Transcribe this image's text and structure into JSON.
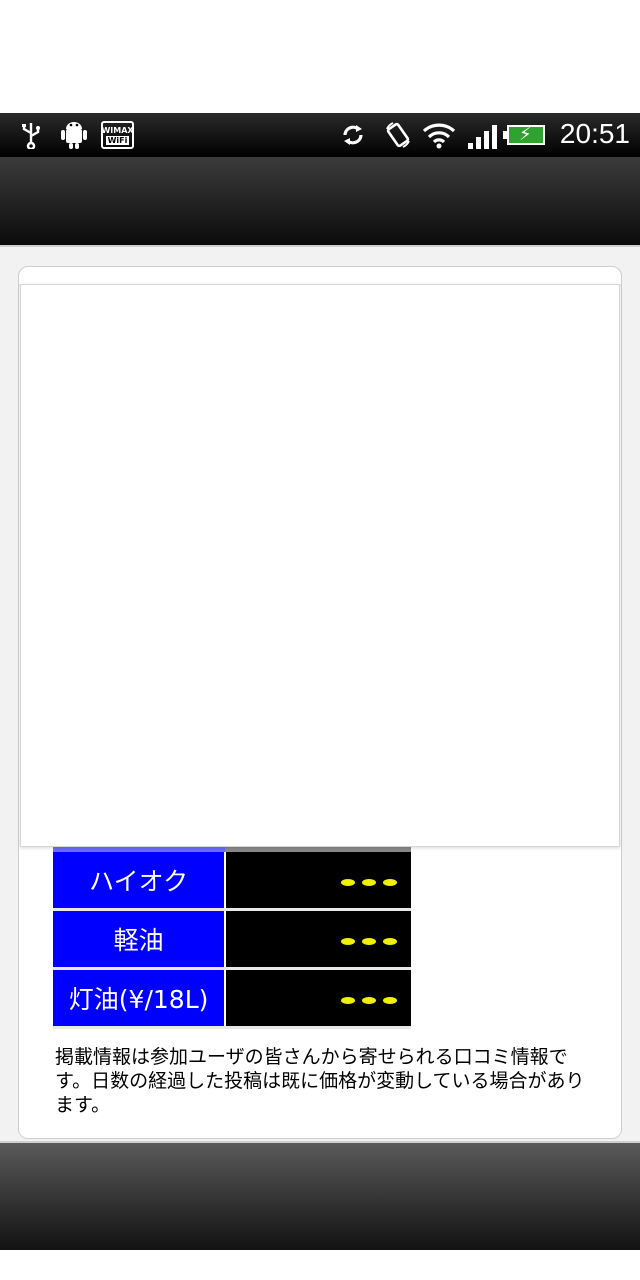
{
  "status_bar": {
    "time": "20:51",
    "icons": [
      "usb-icon",
      "android-debug-icon",
      "wimax-wifi-icon",
      "sync-icon",
      "rotate-icon",
      "wifi-icon",
      "signal-icon",
      "battery-charging-icon"
    ],
    "wimax_label": "WIMAX",
    "wimax_sub": "WiFi"
  },
  "price_table": {
    "rows": [
      {
        "fuel": "ハイオク"
      },
      {
        "fuel": "軽油"
      },
      {
        "fuel": "灯油(¥/18L)"
      }
    ]
  },
  "notice": "掲載情報は参加ユーザの皆さんから寄せられる口コミ情報です。日数の経過した投稿は既に価格が変動している場合があります。",
  "colors": {
    "fuel_label_bg": "#0000ff",
    "price_cell_bg": "#000000",
    "price_dots": "#f0f000"
  }
}
